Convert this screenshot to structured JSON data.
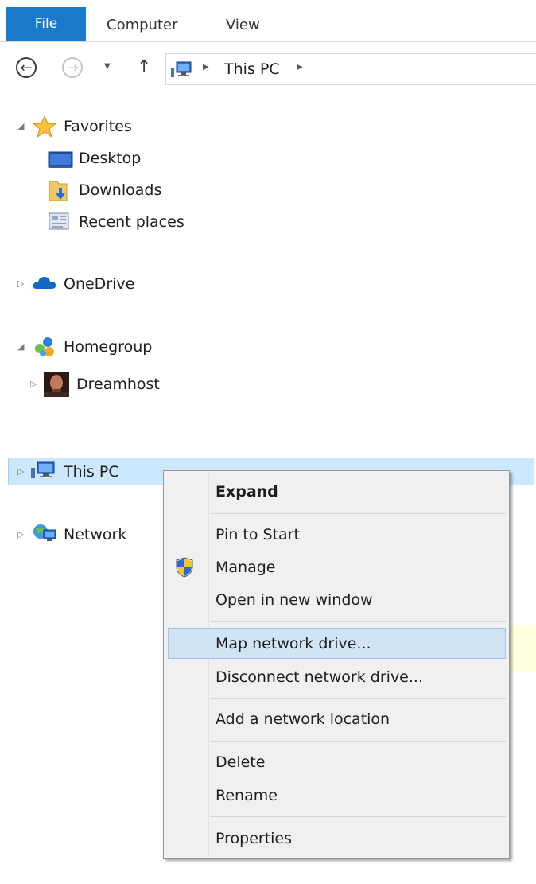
{
  "ribbon": {
    "tabs": [
      "File",
      "Computer",
      "View"
    ]
  },
  "address": {
    "location": "This PC"
  },
  "tree": {
    "favorites": "Favorites",
    "desktop": "Desktop",
    "downloads": "Downloads",
    "recent_places": "Recent places",
    "onedrive": "OneDrive",
    "homegroup": "Homegroup",
    "dreamhost": "Dreamhost",
    "this_pc": "This PC",
    "network": "Network"
  },
  "context_menu": {
    "expand": "Expand",
    "pin_to_start": "Pin to Start",
    "manage": "Manage",
    "open_new_window": "Open in new window",
    "map_network_drive": "Map network drive...",
    "disconnect_network_drive": "Disconnect network drive...",
    "add_network_location": "Add a network location",
    "delete": "Delete",
    "rename": "Rename",
    "properties": "Properties"
  },
  "colors": {
    "file_tab": "#1979ca",
    "selection": "#cce8ff",
    "menu_hover": "#d1e4f6",
    "menu_background": "#f0f0f0",
    "tooltip": "#ffffe1"
  }
}
